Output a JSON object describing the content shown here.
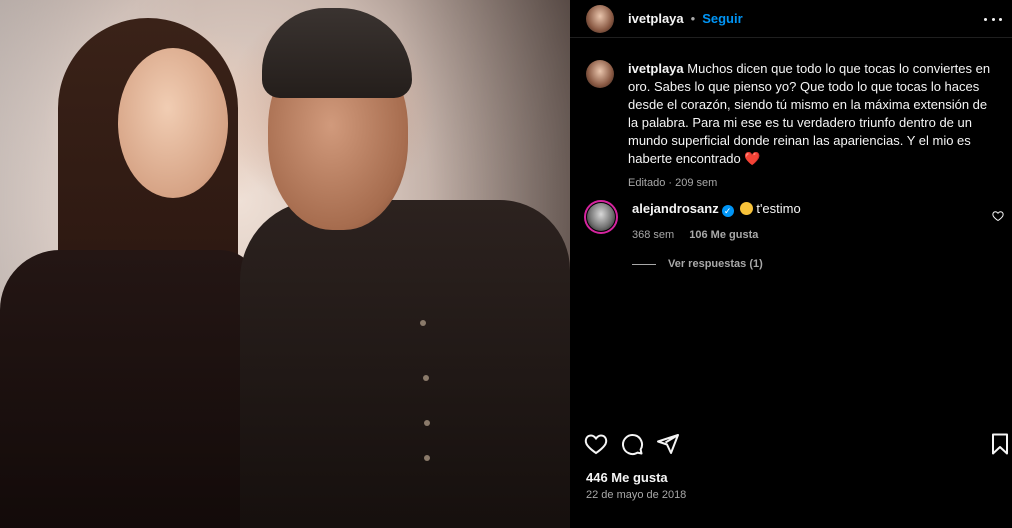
{
  "post": {
    "username": "ivetplaya",
    "separator": "•",
    "follow_label": "Seguir"
  },
  "caption": {
    "username": "ivetplaya",
    "text": "Muchos dicen que todo lo que tocas lo conviertes en oro. Sabes lo que pienso yo? Que todo lo que tocas lo haces desde el corazón, siendo tú mismo en la máxima extensión de la palabra. Para mi ese es tu verdadero triunfo dentro de un mundo superficial donde reinan las apariencias. Y el mio es haberte encontrado",
    "emoji": "❤️",
    "edited": "Editado",
    "edited_sep": "·",
    "time": "209 sem"
  },
  "comment": {
    "username": "alejandrosanz",
    "verified_glyph": "✓",
    "text": "t'estimo",
    "time": "368 sem",
    "likes": "106 Me gusta",
    "replies_label": "Ver respuestas (1)"
  },
  "footer": {
    "likes": "446 Me gusta",
    "date": "22 de mayo de 2018"
  },
  "icons": {
    "like": "heart-icon",
    "comment": "comment-bubble-icon",
    "share": "paper-plane-icon",
    "save": "bookmark-icon",
    "more": "more-horizontal-icon"
  },
  "colors": {
    "background": "#000000",
    "text": "#f5f5f5",
    "secondary": "#a8a8a8",
    "accent": "#0095f6",
    "heart": "#ed4956"
  }
}
